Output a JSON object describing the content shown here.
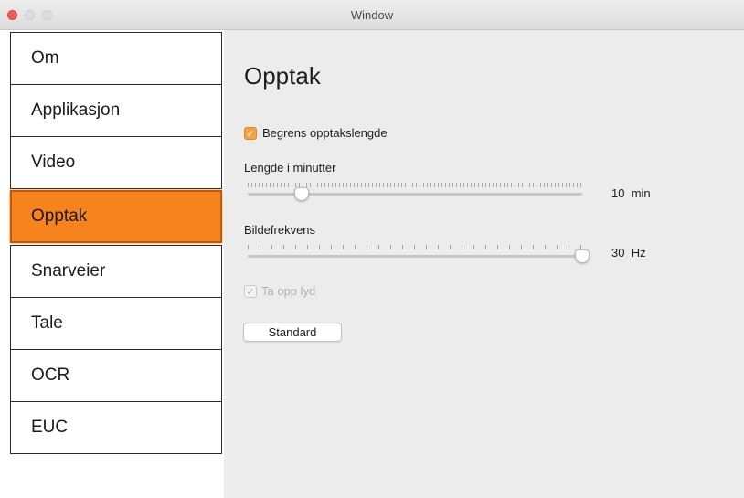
{
  "window": {
    "title": "Window",
    "buttons": {
      "close": "close-button",
      "minimize": "minimize-button",
      "zoom": "zoom-button"
    }
  },
  "sidebar": {
    "items": [
      {
        "label": "Om",
        "active": false
      },
      {
        "label": "Applikasjon",
        "active": false
      },
      {
        "label": "Video",
        "active": false
      },
      {
        "label": "Opptak",
        "active": true
      },
      {
        "label": "Snarveier",
        "active": false
      },
      {
        "label": "Tale",
        "active": false
      },
      {
        "label": "OCR",
        "active": false
      },
      {
        "label": "EUC",
        "active": false
      }
    ]
  },
  "main": {
    "heading": "Opptak",
    "limit_checkbox": {
      "label": "Begrens opptakslengde",
      "checked": true,
      "enabled": true
    },
    "length_slider": {
      "label": "Lengde i minutter",
      "value": "10",
      "unit": "min",
      "fraction": 0.16
    },
    "framerate_slider": {
      "label": "Bildefrekvens",
      "value": "30",
      "unit": "Hz",
      "fraction": 1.0
    },
    "audio_checkbox": {
      "label": "Ta opp lyd",
      "checked": true,
      "enabled": false
    },
    "standard_button": "Standard"
  },
  "colors": {
    "accent": "#f7831f",
    "checkbox": "#f5a340",
    "close": "#f25a57"
  }
}
